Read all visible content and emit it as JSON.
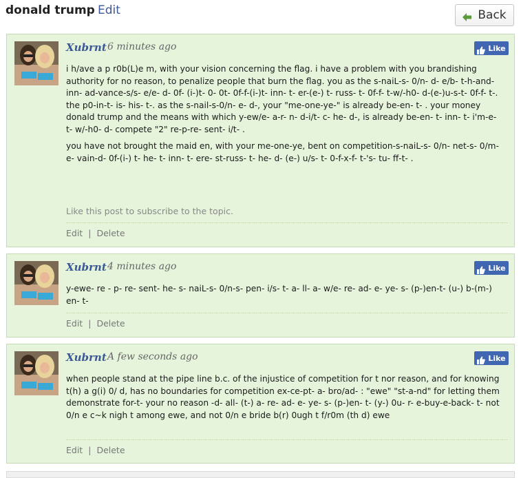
{
  "header": {
    "title": "donald trump",
    "edit_label": "Edit",
    "back_label": "Back"
  },
  "posts": [
    {
      "author": "Xubrnt",
      "time": "6 minutes ago",
      "like_label": "Like",
      "paragraphs": [
        "i h/ave a p r0b(L)e m, with your vision concerning the flag. i have a problem with you brandishing authority for no reason, to penalize people that burn the flag. you as the s-naiL-s- 0/n- d- e/b- t-h-and- inn- ad-vance-s/s- e/e- d- 0f- (i-)t- 0- 0t- 0f-f-(i-)t- inn- t- er-(e-) t- russ- t- 0f-f- t-w/-h0- d-(e-)u-s-t- 0f-f- t-. the p0-in-t- is- his- t-. as the s-nail-s-0/n- e- d-, your \"me-one-ye-\" is already be-en- t- . your money donald trump and the means with which y-ew/e- a-r- n- d-i/t- c- he- d-, is already be-en- t- inn- t- i'm-e- t- w/-h0- d- compete \"2\" re-p-re- sent- i/t- .",
        "you have not brought the maid en, with your me-one-ye, bent on competition-s-naiL-s- 0/n- net-s- 0/m-e- vain-d- 0f-(i-) t- he- t- inn- t- ere- st-russ- t- he- d- (e-) u/s- t- 0-f-x-f- t-'s- tu- ff-t- ."
      ],
      "subscribe_note": "Like this post to subscribe to the topic.",
      "edit_label": "Edit",
      "delete_label": "Delete"
    },
    {
      "author": "Xubrnt",
      "time": "4 minutes ago",
      "like_label": "Like",
      "paragraphs": [
        "y-ewe- re - p- re- sent- he- s- naiL-s- 0/n-s- pen- i/s- t- a- ll- a- w/e- re- ad- e- ye- s- (p-)en-t- (u-) b-(m-) en- t-"
      ],
      "edit_label": "Edit",
      "delete_label": "Delete"
    },
    {
      "author": "Xubrnt",
      "time": "A few seconds ago",
      "like_label": "Like",
      "paragraphs": [
        "when people stand at the pipe line b.c. of the injustice of competition for t nor reason, and for knowing t(h) a g(i) 0/ d, has no boundaries for competition ex-ce-pt- a- bro/ad- : \"ewe\" \"st-a-nd\" for letting them demonstrate for-t- your no reason -d- all- (t-) a- re- ad- e- ye- s- (p-)en- t- (y-) 0u- r- e-buy-e-back- t- not 0/n e c~k nigh t among ewe, and not 0/n e bride b(r) 0ugh t f/r0m (th d) ewe"
      ],
      "edit_label": "Edit",
      "delete_label": "Delete"
    }
  ],
  "colors": {
    "post_background": "#e6f4dc",
    "post_border": "#c4d9b4",
    "link": "#3b5998",
    "like_button": "#4267b2",
    "back_arrow": "#5a9a3a"
  },
  "icons": {
    "back": "arrow-left-icon",
    "like": "thumbs-up-icon",
    "avatar": "user-avatar-photo"
  }
}
